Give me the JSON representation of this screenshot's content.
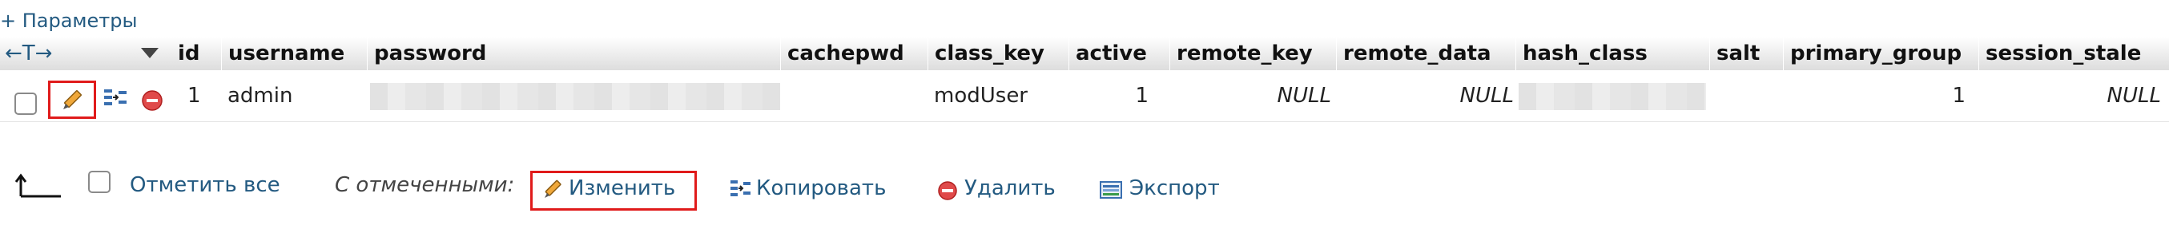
{
  "top": {
    "params_link": "+ Параметры"
  },
  "header": {
    "arrows": "←T→",
    "columns": [
      "id",
      "username",
      "password",
      "cachepwd",
      "class_key",
      "active",
      "remote_key",
      "remote_data",
      "hash_class",
      "salt",
      "primary_group",
      "session_stale"
    ]
  },
  "row": {
    "id": "1",
    "username": "admin",
    "class_key": "modUser",
    "active": "1",
    "remote_key": "NULL",
    "remote_data": "NULL",
    "primary_group": "1",
    "session_stale": "NULL"
  },
  "footer": {
    "check_all": "Отметить все",
    "with_selected": "С отмеченными:",
    "edit": "Изменить",
    "copy": "Копировать",
    "delete": "Удалить",
    "export": "Экспорт"
  },
  "colors": {
    "link": "#235a81",
    "highlight": "#e01b1b",
    "delete": "#e04a4a"
  },
  "icons": [
    "pencil-icon",
    "copy-icon",
    "delete-icon",
    "export-icon",
    "select-arrow-icon"
  ]
}
